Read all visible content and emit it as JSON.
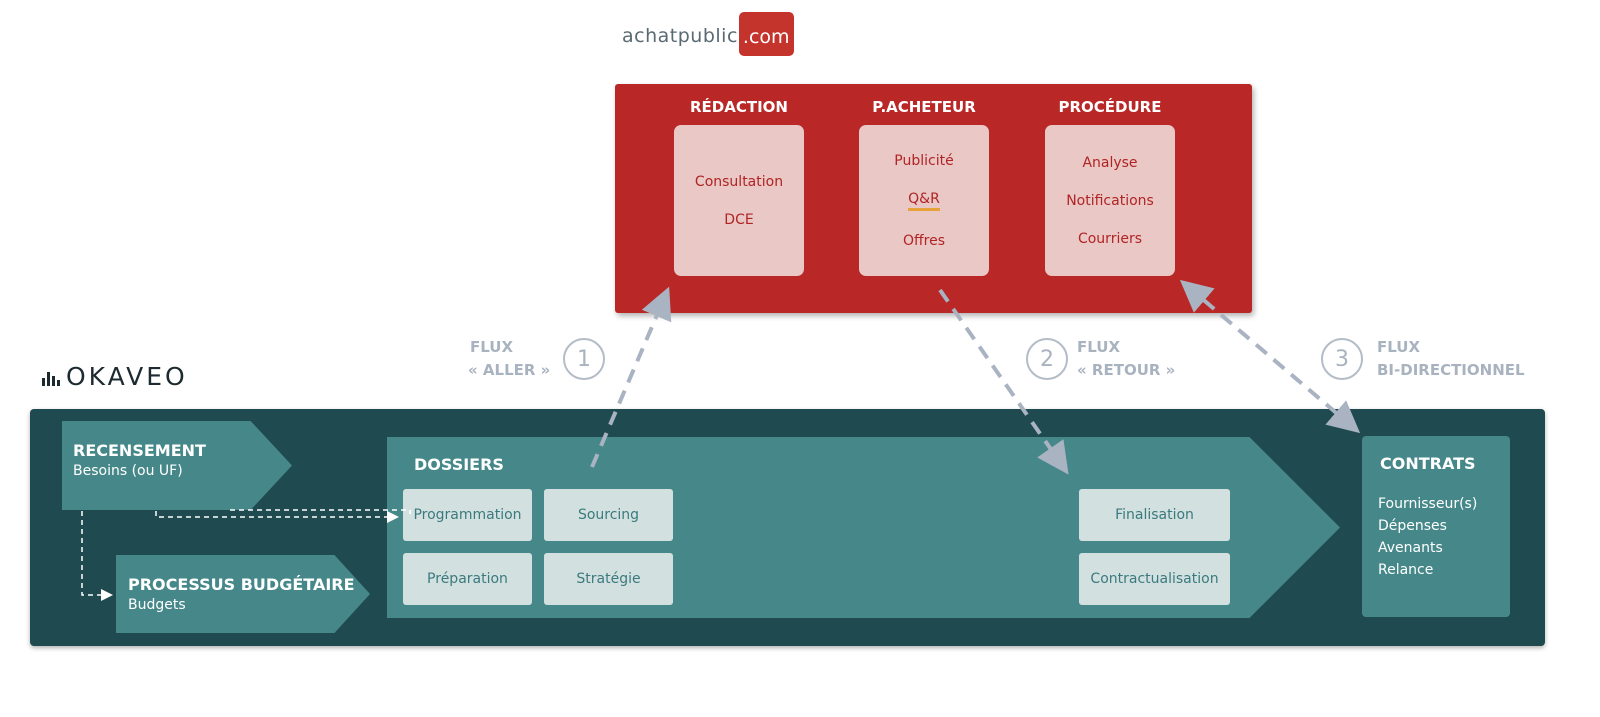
{
  "achatpublic_logo": {
    "part1": "achatpublic",
    "part2": ".com"
  },
  "achatpublic": {
    "columns": [
      {
        "title": "RÉDACTION",
        "items": [
          "Consultation",
          "DCE"
        ]
      },
      {
        "title": "P.ACHETEUR",
        "items": [
          "Publicité",
          "Q&R",
          "Offres"
        ]
      },
      {
        "title": "PROCÉDURE",
        "items": [
          "Analyse",
          "Notifications",
          "Courriers"
        ]
      }
    ]
  },
  "flux": [
    {
      "number": "1",
      "line1": "FLUX",
      "line2": "« ALLER »"
    },
    {
      "number": "2",
      "line1": "FLUX",
      "line2": "« RETOUR »"
    },
    {
      "number": "3",
      "line1": "FLUX",
      "line2": "BI-DIRECTIONNEL"
    }
  ],
  "okaveo_logo": "OKAVEO",
  "okaveo": {
    "recensement": {
      "title": "RECENSEMENT",
      "subtitle": "Besoins (ou UF)"
    },
    "budget": {
      "title": "PROCESSUS BUDGÉTAIRE",
      "subtitle": "Budgets"
    },
    "dossiers": {
      "title": "DOSSIERS",
      "items": [
        "Programmation",
        "Sourcing",
        "Préparation",
        "Stratégie",
        "Finalisation",
        "Contractualisation"
      ]
    },
    "contrats": {
      "title": "CONTRATS",
      "items": [
        "Fournisseur(s)",
        "Dépenses",
        "Avenants",
        "Relance"
      ]
    }
  },
  "colors": {
    "achatpublic_red": "#b92726",
    "okaveo_dark": "#1f4a50",
    "okaveo_teal": "#468889",
    "flux_gray": "#a9b3bf"
  }
}
